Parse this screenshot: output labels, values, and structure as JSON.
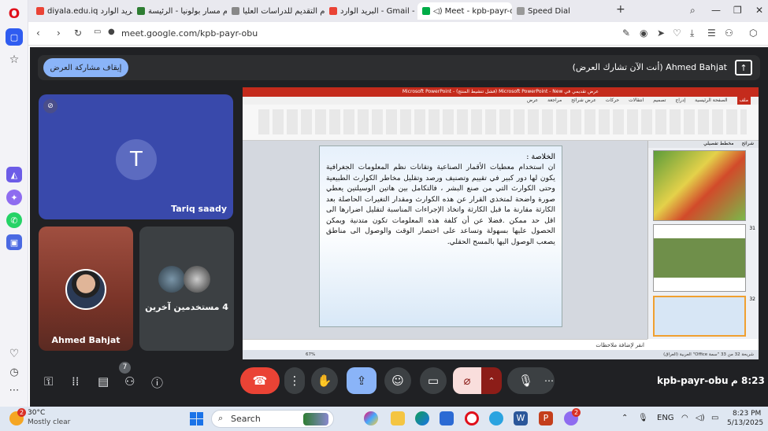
{
  "tabs": [
    {
      "label": "diyala.edu.iq البريد الوارد - "
    },
    {
      "label": "نظام مسار بولونيا - الرئيسة"
    },
    {
      "label": "نظام التقديم للدراسات العليا"
    },
    {
      "label": "البريد الوارد - Gmail - .com"
    },
    {
      "label": "Meet - kpb-payr-o"
    },
    {
      "label": "Speed Dial"
    }
  ],
  "address": {
    "url": "meet.google.com/kpb-payr-obu"
  },
  "presenting": {
    "stop_label": "إيقاف مشاركة العرض",
    "status_label": "Ahmed Bahjat (أنت الآن تشارك العرض)"
  },
  "participants": {
    "tile1_initial": "T",
    "tile1_name": "Tariq saady",
    "tile2_name": "Ahmed Bahjat",
    "tile3_label": "4 مستخدمين آخرين"
  },
  "powerpoint": {
    "window_title": "عرض تقديمي في Microsoft PowerPoint - New (فشل تنشيط المنتج) - Microsoft PowerPoint",
    "ribbon_tabs": [
      "ملف",
      "الصفحة الرئيسية",
      "إدراج",
      "تصميم",
      "انتقالات",
      "حركات",
      "عرض شرائح",
      "مراجعة",
      "عرض"
    ],
    "panel_tabs": [
      "شرائح",
      "مخطط تفصيلي"
    ],
    "slide_heading": "الخلاصة :",
    "slide_body": "ان استخدام معطيات الأقمار الصناعية وتقانات نظم المعلومات الجغرافية يكون لها دور كبير في تقييم وتصنيف ورصد وتقليل مخاطر الكوارث الطبيعية وحتى الكوارث التي من صنع البشر ، فالتكامل بين هاتين الوسيلتين يعطي صورة واضحة لمتخذي القرار عن هذه الكوارث ومقدار التغيرات الحاصلة بعد الكارثة مقارنة ما قبل الكارثة واتخاذ الإجراءات المناسبة لتقليل اضرارها الى اقل حد ممكن .فضلا عن أن كلفة هذه المعلومات تكون متدنية ويمكن الحصول عليها بسهولة وتساعد على اختصار الوقت والوصول الى مناطق يصعب الوصول اليها بالمسح الحقلي.",
    "notes_placeholder": "انقر لإضافة ملاحظات",
    "status_text": "شريحة 32 من 33   \"سمة Office\"   العربية (العراق)",
    "zoom": "67%",
    "thumb_numbers": [
      "31",
      "32"
    ]
  },
  "meeting": {
    "code": "kpb-payr-obu",
    "time": "8:23 م",
    "participants_count": "7"
  },
  "taskbar": {
    "weather_temp": "30°C",
    "weather_desc": "Mostly clear",
    "weather_badge": "2",
    "search_placeholder": "Search",
    "lang": "ENG",
    "time": "8:23 PM",
    "date": "5/13/2025",
    "badge": "2"
  }
}
